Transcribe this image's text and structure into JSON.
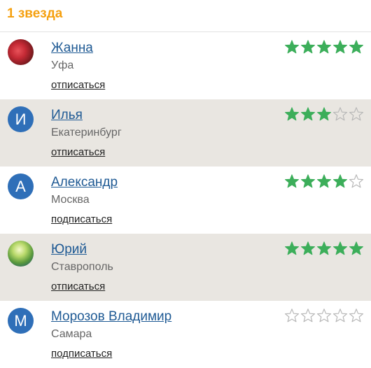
{
  "header": {
    "title": "1 звезда"
  },
  "users": [
    {
      "name": "Жанна",
      "city": "Уфа",
      "action": "отписаться",
      "avatar": {
        "type": "photo1",
        "letter": ""
      },
      "rating": 5
    },
    {
      "name": "Илья",
      "city": "Екатеринбург",
      "action": "отписаться",
      "avatar": {
        "type": "letter",
        "letter": "И"
      },
      "rating": 3
    },
    {
      "name": "Александр",
      "city": "Москва",
      "action": "подписаться",
      "avatar": {
        "type": "letter",
        "letter": "А"
      },
      "rating": 4
    },
    {
      "name": "Юрий",
      "city": "Ставрополь",
      "action": "отписаться",
      "avatar": {
        "type": "photo2",
        "letter": ""
      },
      "rating": 5
    },
    {
      "name": "Морозов Владимир",
      "city": "Самара",
      "action": "подписаться",
      "avatar": {
        "type": "letter",
        "letter": "М"
      },
      "rating": 0
    }
  ],
  "colors": {
    "accent": "#f5a00f",
    "link": "#1f5a94",
    "star_on": "#3cae5a",
    "star_off": "#b8b8b8",
    "avatar_bg": "#2f6fb8",
    "alt_row": "#e9e6e1"
  },
  "max_stars": 5
}
